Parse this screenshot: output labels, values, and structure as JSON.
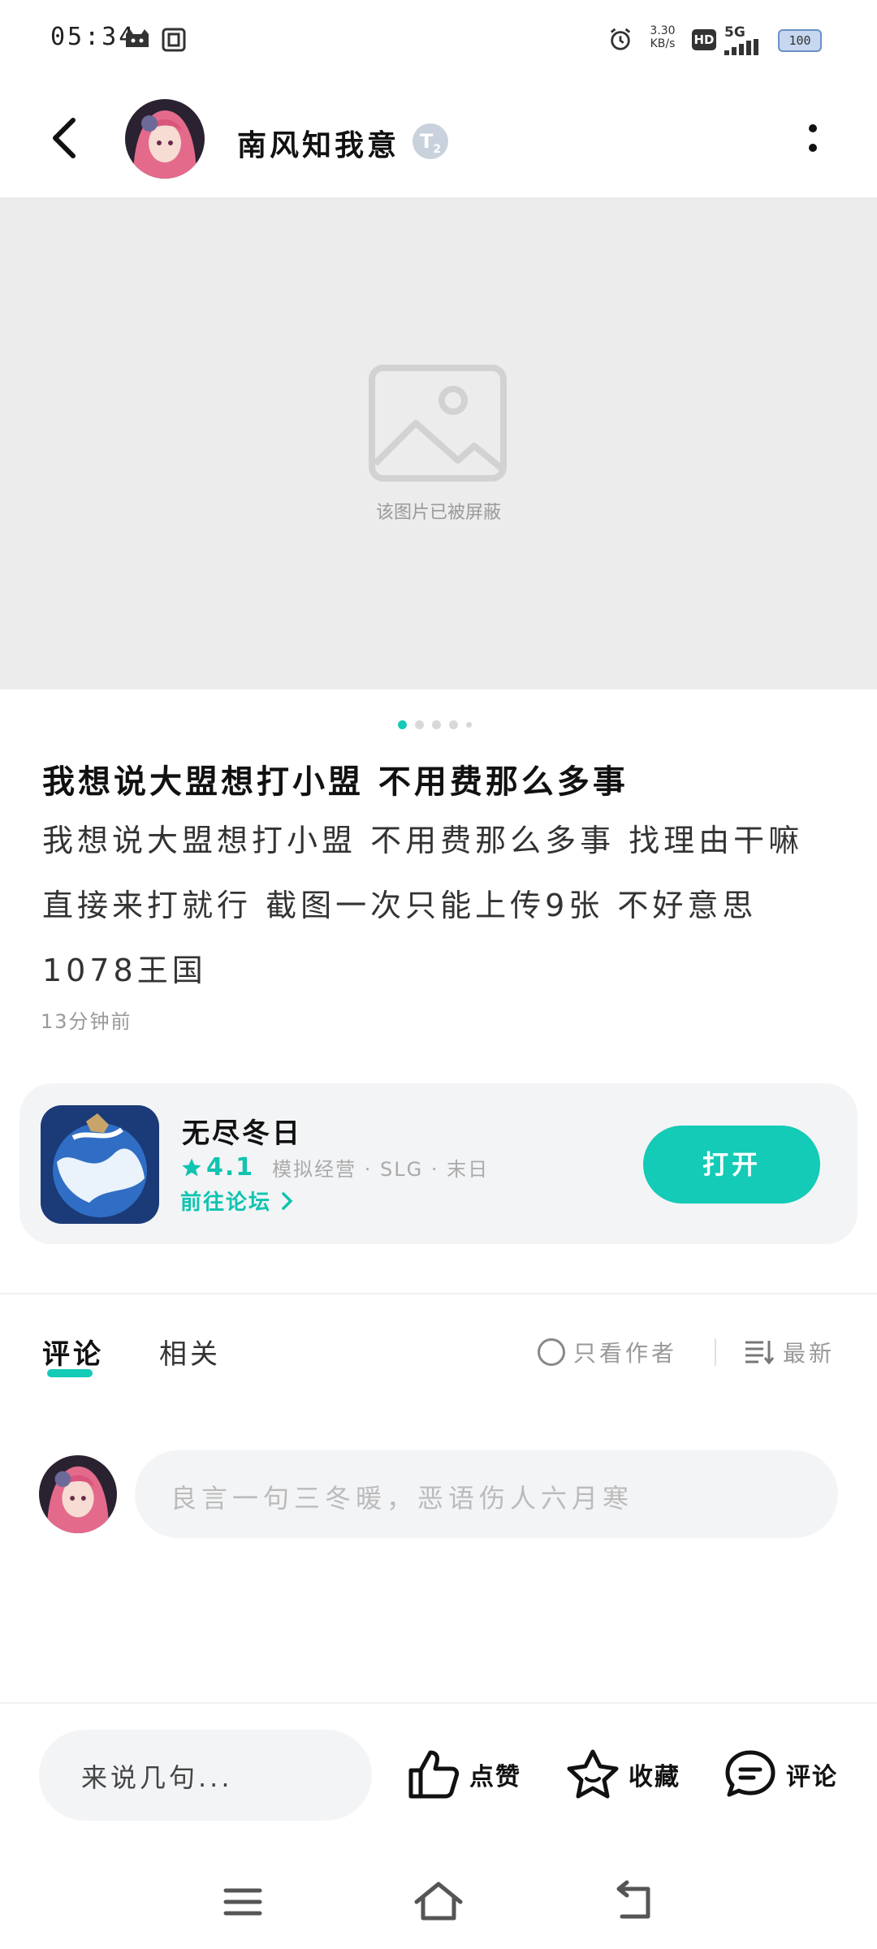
{
  "status_bar": {
    "time": "05:34",
    "network_speed": "3.30",
    "network_unit": "KB/s",
    "hd_label": "HD",
    "network_type": "5G",
    "battery": "100"
  },
  "header": {
    "username": "南风知我意",
    "level": "T",
    "level_sub": "2"
  },
  "image": {
    "blocked_text": "该图片已被屏蔽"
  },
  "post": {
    "title": "我想说大盟想打小盟 不用费那么多事",
    "body": "我想说大盟想打小盟 不用费那么多事 找理由干嘛 直接来打就行 截图一次只能上传9张 不好意思 1078王国",
    "time": "13分钟前"
  },
  "game_card": {
    "name": "无尽冬日",
    "rating": "4.1",
    "tags": "模拟经营 · SLG · 末日",
    "forum_link": "前往论坛",
    "open_label": "打开"
  },
  "tabs": {
    "comments": "评论",
    "related": "相关",
    "only_author": "只看作者",
    "sort": "最新"
  },
  "comment_box": {
    "placeholder": "良言一句三冬暖，恶语伤人六月寒"
  },
  "bottom_bar": {
    "say_placeholder": "来说几句...",
    "like": "点赞",
    "favorite": "收藏",
    "comment": "评论"
  },
  "colors": {
    "accent": "#13cbb6",
    "placeholder_bg": "#ececed",
    "card_bg": "#f3f4f6"
  }
}
